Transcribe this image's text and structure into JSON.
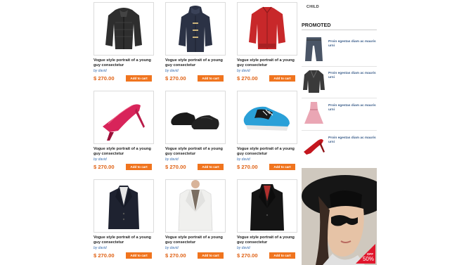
{
  "products": [
    {
      "title": "Vogue style portrait of a young guy consectetur",
      "by": "by david",
      "price": "$ 270.00",
      "button": "Add to cart",
      "icon": "black-jacket-icon",
      "color": "#333333"
    },
    {
      "title": "Vogue style portrait of a young guy consectetur",
      "by": "by david",
      "price": "$ 270.00",
      "button": "Add to cart",
      "icon": "navy-coat-icon",
      "color": "#2b3245"
    },
    {
      "title": "Vogue style portrait of a young guy consectetur",
      "by": "by david",
      "price": "$ 270.00",
      "button": "Add to cart",
      "icon": "red-jacket-icon",
      "color": "#c8282a"
    },
    {
      "title": "Vogue style portrait of a young guy consectetur",
      "by": "by david",
      "price": "$ 270.00",
      "button": "Add to cart",
      "icon": "red-heels-icon",
      "color": "#d8245a"
    },
    {
      "title": "Vogue style portrait of a young guy consectetur",
      "by": "by david",
      "price": "$ 270.00",
      "button": "Add to cart",
      "icon": "black-shoes-icon",
      "color": "#1a1a1a"
    },
    {
      "title": "Vogue style portrait of a young guy consectetur",
      "by": "by david",
      "price": "$ 270.00",
      "button": "Add to cart",
      "icon": "sneaker-icon",
      "color": "#2aa0d8"
    },
    {
      "title": "Vogue style portrait of a young guy consectetur",
      "by": "by david",
      "price": "$ 270.00",
      "button": "Add to cart",
      "icon": "blazer-icon",
      "color": "#1e2230"
    },
    {
      "title": "Vogue style portrait of a young guy consectetur",
      "by": "by david",
      "price": "$ 270.00",
      "button": "Add to cart",
      "icon": "white-blazer-icon",
      "color": "#f0f0ee"
    },
    {
      "title": "Vogue style portrait of a young guy consectetur",
      "by": "by david",
      "price": "$ 270.00",
      "button": "Add to cart",
      "icon": "suit-icon",
      "color": "#151515"
    }
  ],
  "sidebar": {
    "child_label": "CHILD",
    "promoted_title": "PROMOTED",
    "items": [
      {
        "text": "Proin egestas diam ac mauris urni",
        "icon": "jeans-icon"
      },
      {
        "text": "Proin egestas diam ac mauris urni",
        "icon": "leather-jacket-icon"
      },
      {
        "text": "Proin egestas diam ac mauris urni",
        "icon": "pink-dress-icon"
      },
      {
        "text": "Proin egestas diam ac mauris urni",
        "icon": "red-heels-icon"
      }
    ],
    "banner": {
      "off_label": "OFF",
      "off_value": "50%"
    }
  },
  "colors": {
    "accent": "#f0741e",
    "price": "#e06316",
    "link": "#3a6fb0"
  }
}
